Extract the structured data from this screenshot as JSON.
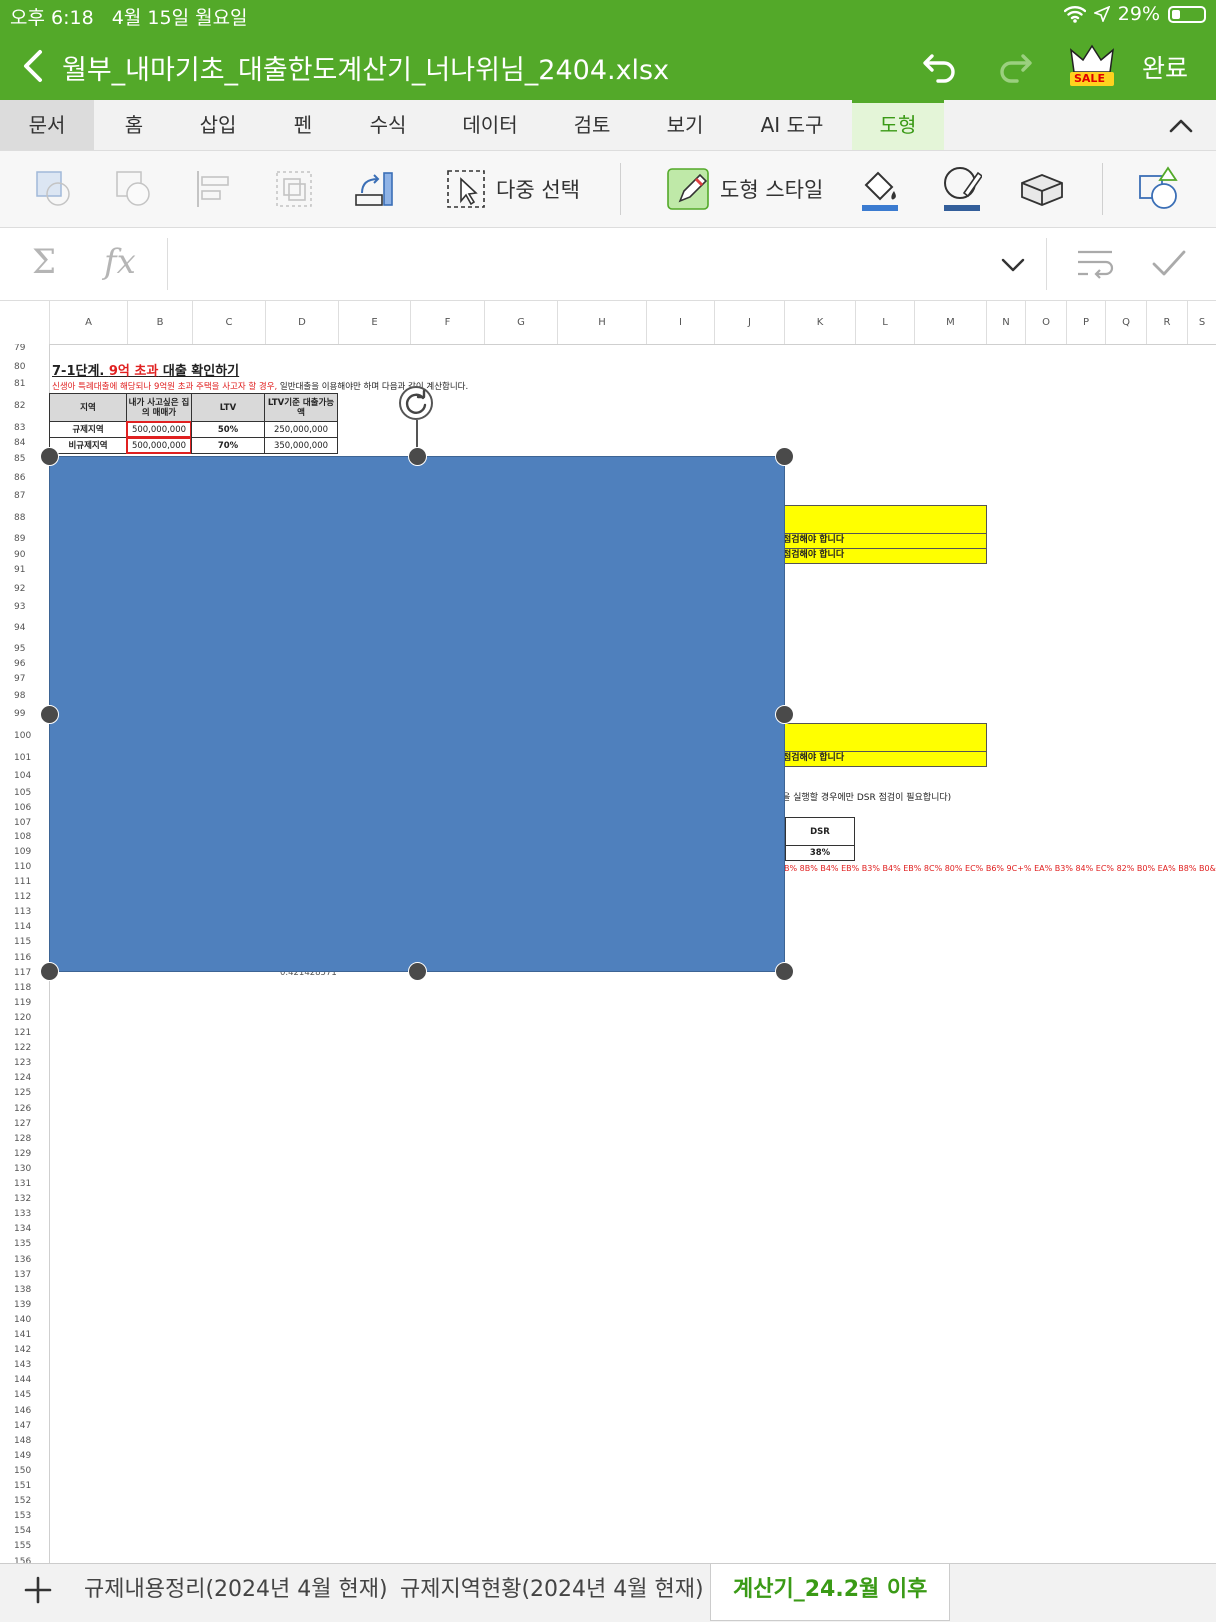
{
  "status": {
    "time": "오후 6:18",
    "date": "4월 15일 월요일",
    "battery": "29%"
  },
  "title_bar": {
    "file_name": "월부_내마기초_대출한도계산기_너나위님_2404.xlsx",
    "premium_badge": "SALE",
    "done_label": "완료"
  },
  "ribbon_tabs": [
    {
      "label": "문서"
    },
    {
      "label": "홈"
    },
    {
      "label": "삽입"
    },
    {
      "label": "펜"
    },
    {
      "label": "수식"
    },
    {
      "label": "데이터"
    },
    {
      "label": "검토"
    },
    {
      "label": "보기"
    },
    {
      "label": "AI 도구"
    },
    {
      "label": "도형",
      "active": true
    }
  ],
  "toolbar": {
    "multi_select_label": "다중 선택",
    "shape_style_label": "도형 스타일"
  },
  "formula_bar": {
    "sum_symbol": "Σ",
    "fx_symbol": "fx",
    "value": ""
  },
  "columns": [
    "A",
    "B",
    "C",
    "D",
    "E",
    "F",
    "G",
    "H",
    "I",
    "J",
    "K",
    "L",
    "M",
    "N",
    "O",
    "P",
    "Q",
    "R",
    "S"
  ],
  "rows_first": 79,
  "rows_last": 156,
  "sheet": {
    "heading_prefix": "7-1단계. ",
    "heading_red": "9억 초과",
    "heading_suffix": " 대출 확인하기",
    "note_red": "신생아 특례대출에 해당되나 9억원 초과 주택을 사고자 할 경우,",
    "note_black": " 일반대출을 이용해야만 하며 다음과 같이 계산합니다.",
    "table_headers": [
      "지역",
      "내가 사고싶은 집의 매매가",
      "LTV",
      "LTV기준 대출가능액"
    ],
    "table_rows": [
      [
        "규제지역",
        "500,000,000",
        "50%",
        "250,000,000"
      ],
      [
        "비규제지역",
        "500,000,000",
        "70%",
        "350,000,000"
      ]
    ],
    "check_text_1": "점검해야 합니다",
    "check_text_2": "점검해야 합니다",
    "check_text_3": "점검해야 합니다",
    "dsr_note": "을 실행할 경우에만 DSR 점검이 필요합니다)",
    "dsr_header": "DSR",
    "dsr_value": "38%",
    "encoded_text": "B% 8B% B4% EB% B3% B4% EB% 8C% 80% EC% B6% 9C+% EA% B3% 84% EC% 82% B0% EA% B8% B0&oq",
    "hidden_value": "0.421428571"
  },
  "sheet_tabs": [
    {
      "label": "규제내용정리(2024년 4월 현재)"
    },
    {
      "label": "규제지역현황(2024년 4월 현재)"
    },
    {
      "label": "계산기_24.2월 이후",
      "active": true
    }
  ],
  "colors": {
    "brand_green": "#53a929",
    "shape_fill": "#4f80bd",
    "highlight_yellow": "#ffff00",
    "accent_red": "#e02020"
  }
}
